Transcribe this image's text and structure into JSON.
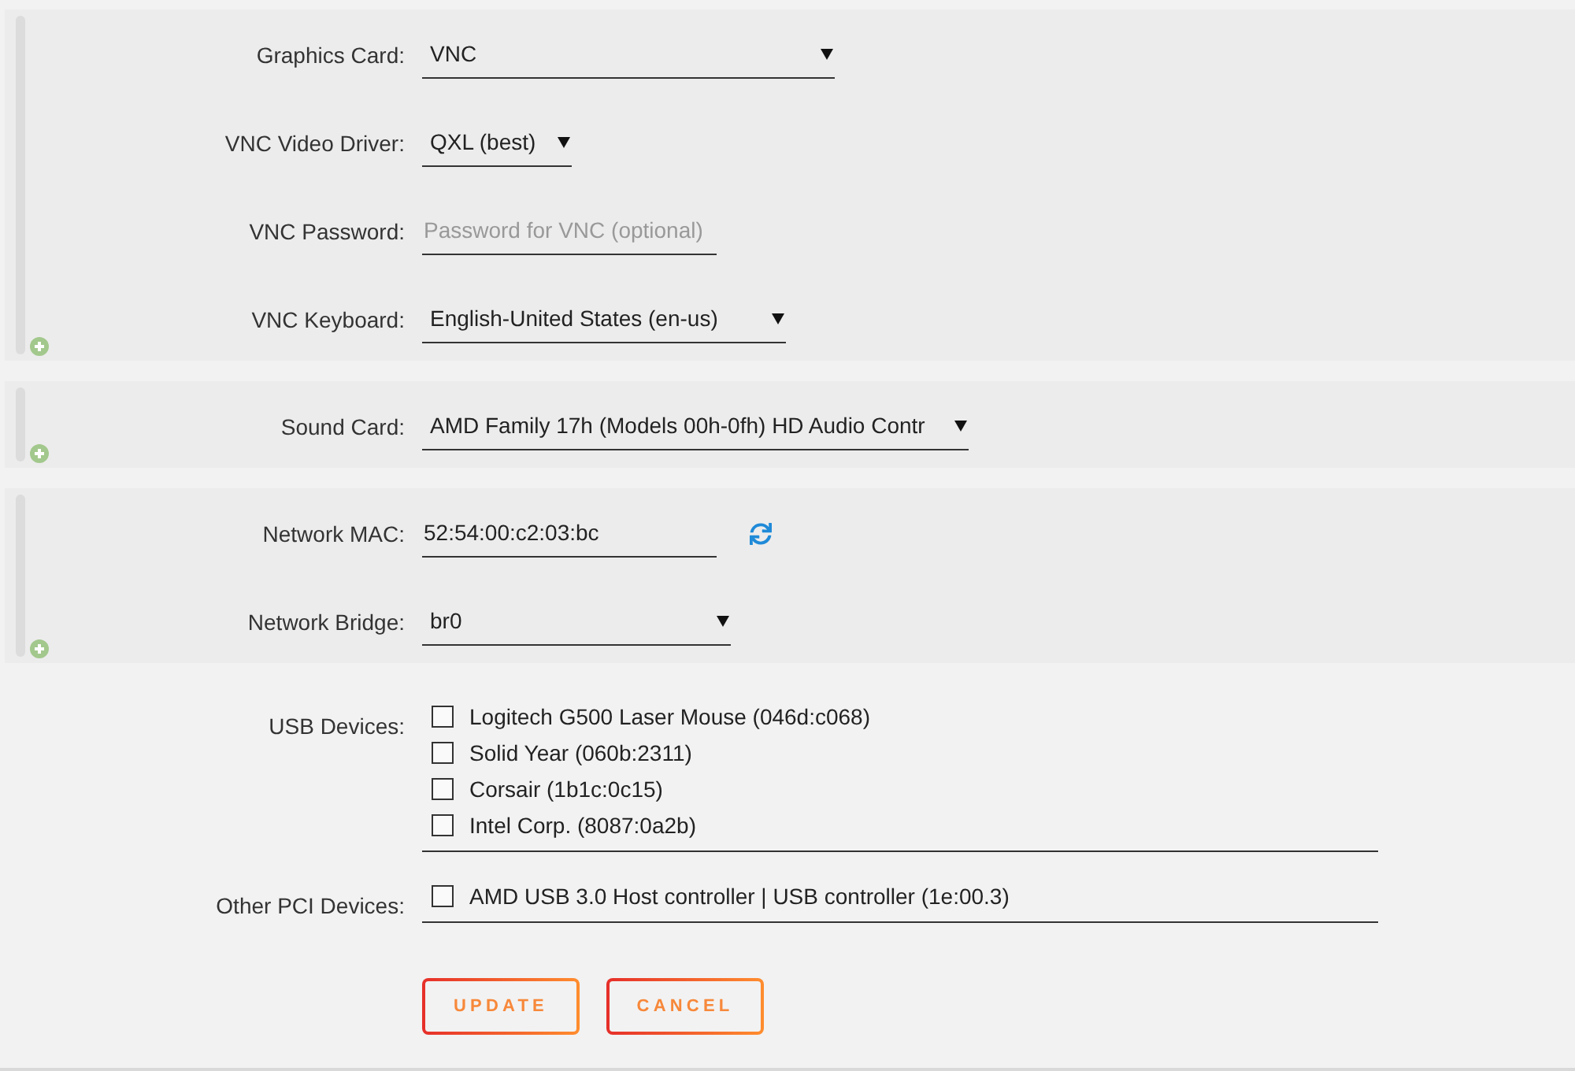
{
  "sections": [
    {
      "fields": [
        {
          "kind": "select",
          "label": "Graphics Card:",
          "value": "VNC"
        },
        {
          "kind": "select",
          "label": "VNC Video Driver:",
          "value": "QXL (best)"
        },
        {
          "kind": "password",
          "label": "VNC Password:",
          "placeholder": "Password for VNC (optional)"
        },
        {
          "kind": "select",
          "label": "VNC Keyboard:",
          "value": "English-United States (en-us)"
        }
      ]
    },
    {
      "fields": [
        {
          "kind": "select",
          "label": "Sound Card:",
          "value": "AMD Family 17h (Models 00h-0fh) HD Audio Contr"
        }
      ]
    },
    {
      "fields": [
        {
          "kind": "mac",
          "label": "Network MAC:",
          "value": "52:54:00:c2:03:bc"
        },
        {
          "kind": "select",
          "label": "Network Bridge:",
          "value": "br0"
        }
      ]
    }
  ],
  "usb_devices": {
    "label": "USB Devices:",
    "items": [
      {
        "label": "Logitech G500 Laser Mouse (046d:c068)",
        "checked": false
      },
      {
        "label": "Solid Year (060b:2311)",
        "checked": false
      },
      {
        "label": "Corsair (1b1c:0c15)",
        "checked": false
      },
      {
        "label": "Intel Corp. (8087:0a2b)",
        "checked": false
      }
    ]
  },
  "other_pci_devices": {
    "label": "Other PCI Devices:",
    "items": [
      {
        "label": "AMD USB 3.0 Host controller | USB controller (1e:00.3)",
        "checked": false
      }
    ]
  },
  "buttons": [
    "UPDATE",
    "CANCEL"
  ]
}
